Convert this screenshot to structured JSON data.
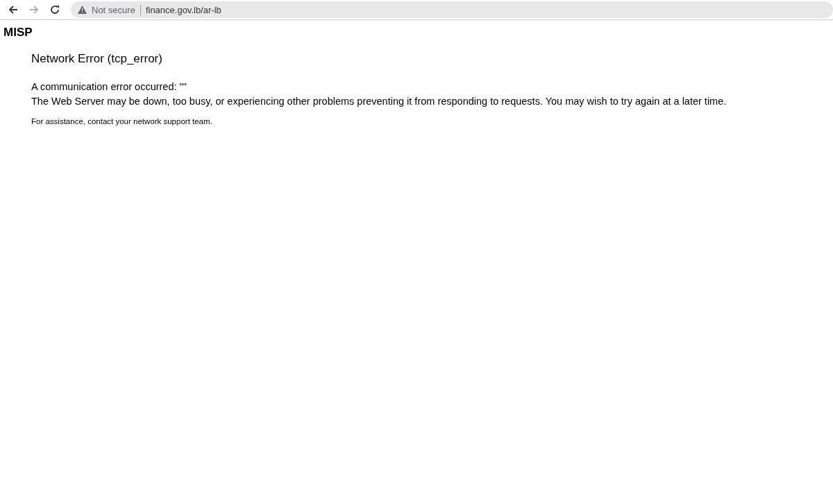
{
  "browser": {
    "nav_buttons": [
      {
        "kind": "back",
        "disabled": false
      },
      {
        "kind": "forward",
        "disabled": true
      },
      {
        "kind": "reload",
        "disabled": false
      }
    ],
    "address_bar": {
      "security_label": "Not secure",
      "url": "finance.gov.lb/ar-lb"
    }
  },
  "page": {
    "site_title": "MISP",
    "error_title": "Network Error (tcp_error)",
    "lines": [
      "A communication error occurred: \"\"",
      "The Web Server may be down, too busy, or experiencing other problems preventing it from responding to requests. You may wish to try again at a later time."
    ],
    "footer_note": "For assistance, contact your network support team."
  }
}
